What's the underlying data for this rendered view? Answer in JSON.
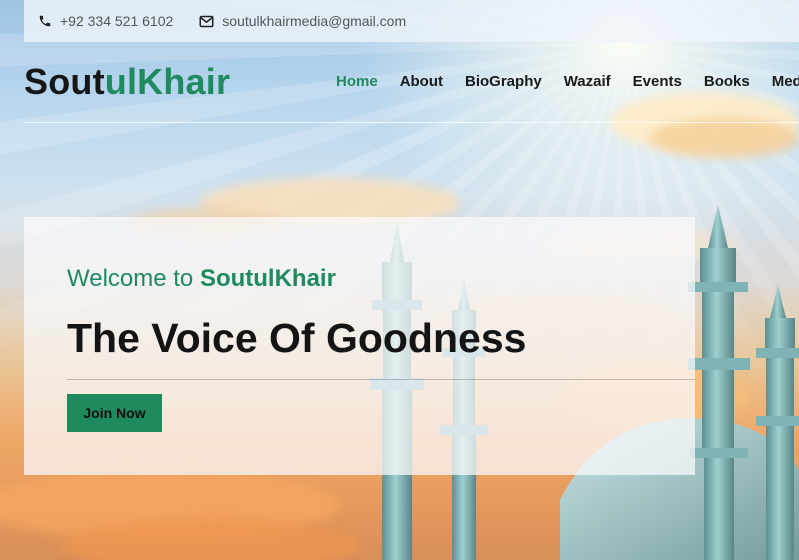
{
  "topbar": {
    "phone": "+92 334 521 6102",
    "email": "soutulkhairmedia@gmail.com",
    "phone_icon": "phone-icon",
    "email_icon": "envelope-icon"
  },
  "logo": {
    "part1": "Sout",
    "part2": "ulKhair"
  },
  "nav": {
    "items": [
      {
        "label": "Home",
        "active": true
      },
      {
        "label": "About",
        "active": false
      },
      {
        "label": "BioGraphy",
        "active": false
      },
      {
        "label": "Wazaif",
        "active": false
      },
      {
        "label": "Events",
        "active": false
      },
      {
        "label": "Books",
        "active": false
      },
      {
        "label": "Media",
        "active": false
      }
    ]
  },
  "hero": {
    "welcome_prefix": "Welcome to ",
    "welcome_brand": "SoutulKhair",
    "headline": "The Voice Of Goodness",
    "button_label": "Join Now"
  },
  "colors": {
    "brand_green": "#1e8a5e",
    "text_dark": "#161616",
    "topbar_text": "#555555"
  }
}
